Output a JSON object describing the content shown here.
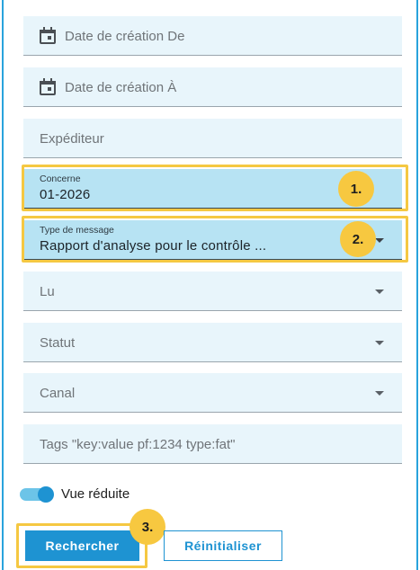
{
  "fields": {
    "date_from": {
      "placeholder": "Date de création De"
    },
    "date_to": {
      "placeholder": "Date de création À"
    },
    "sender": {
      "placeholder": "Expéditeur"
    },
    "concerne": {
      "label": "Concerne",
      "value": "01-2026"
    },
    "message_type": {
      "label": "Type de message",
      "value": "Rapport d'analyse pour le contrôle ..."
    },
    "read": {
      "placeholder": "Lu"
    },
    "status": {
      "placeholder": "Statut"
    },
    "channel": {
      "placeholder": "Canal"
    },
    "tags": {
      "placeholder": "Tags \"key:value pf:1234 type:fat\""
    }
  },
  "toggle": {
    "label": "Vue réduite",
    "on": true
  },
  "buttons": {
    "search": "Rechercher",
    "reset": "Réinitialiser"
  },
  "annotations": [
    "1.",
    "2.",
    "3."
  ],
  "colors": {
    "accent": "#1e93d2",
    "highlight": "#f5c842",
    "field_bg": "#e8f5fb",
    "field_filled": "#b7e3f3"
  }
}
